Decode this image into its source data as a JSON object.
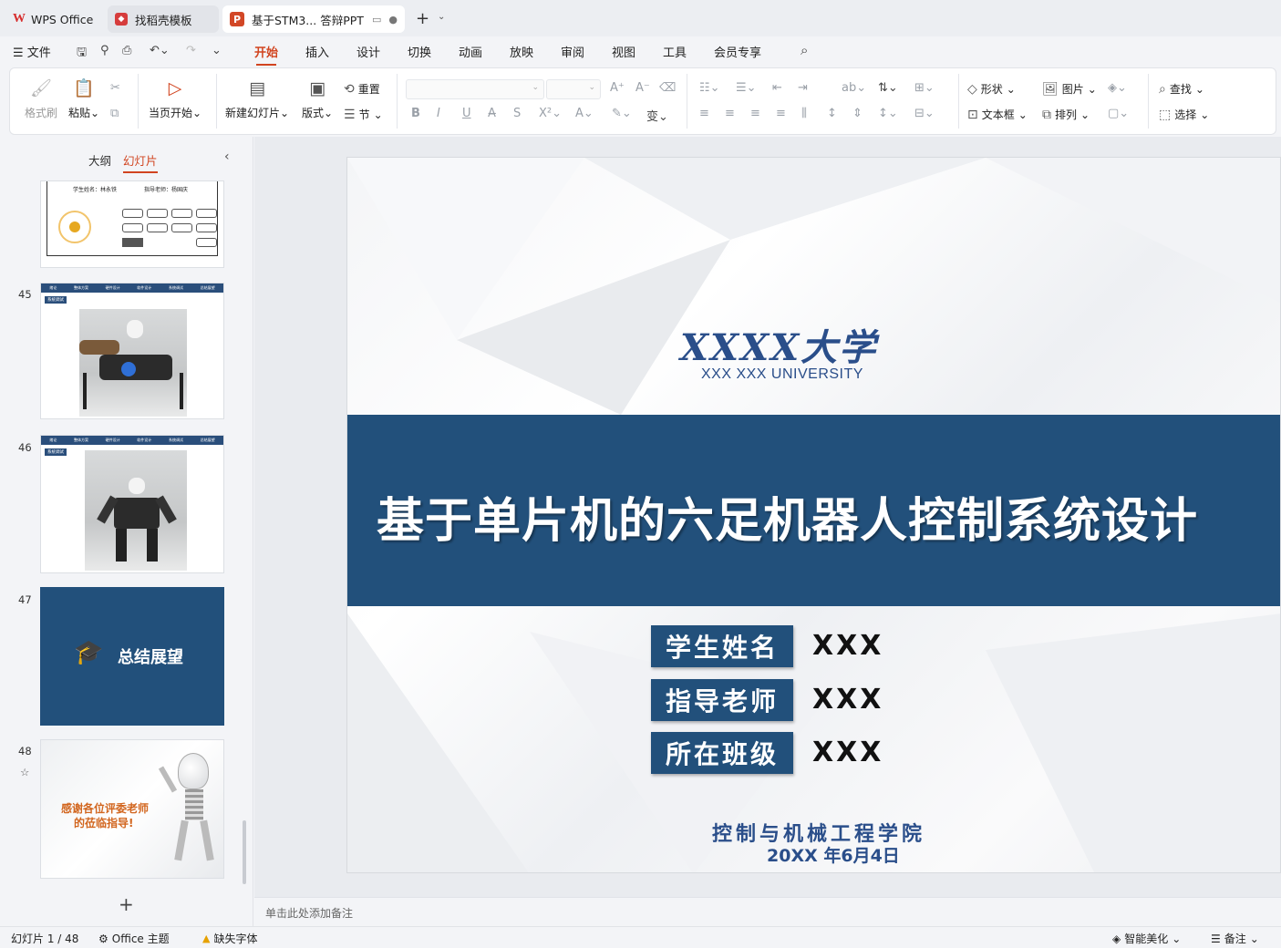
{
  "titlebar": {
    "tabs": [
      {
        "label": "WPS Office"
      },
      {
        "label": "找稻壳模板"
      },
      {
        "label": "基于STM3... 答辩PPT"
      }
    ],
    "new_tab": "+"
  },
  "menu": {
    "file": "文件",
    "items": [
      "开始",
      "插入",
      "设计",
      "切换",
      "动画",
      "放映",
      "审阅",
      "视图",
      "工具",
      "会员专享"
    ],
    "active": "开始"
  },
  "ribbon": {
    "format_painter": "格式刷",
    "paste": "粘贴",
    "from_current": "当页开始",
    "new_slide": "新建幻灯片",
    "layout": "版式",
    "reset": "重置",
    "section": "节",
    "shape": "形状",
    "picture": "图片",
    "textbox": "文本框",
    "arrange": "排列",
    "find": "查找",
    "select": "选择"
  },
  "panel": {
    "tab_outline": "大纲",
    "tab_slides": "幻灯片",
    "slide_numbers": [
      "45",
      "46",
      "47",
      "48"
    ],
    "thumb44": {
      "student": "学生姓名：林永铁",
      "teacher": "指导老师：杨国庆"
    },
    "nav_items": [
      "绪论",
      "整体方案",
      "硬件设计",
      "软件设计",
      "系统调试",
      "总结展望"
    ],
    "section_tag": "系统调试",
    "thumb47_title": "总结展望",
    "thumb48_text_line1": "感谢各位评委老师",
    "thumb48_text_line2": "的莅临指导!"
  },
  "slide": {
    "university_cn": "XXXX大学",
    "university_en": "XXX  XXX  UNIVERSITY",
    "title": "基于单片机的六足机器人控制系统设计",
    "fields": [
      {
        "label": "学生姓名",
        "value": "XXX"
      },
      {
        "label": "指导老师",
        "value": "XXX"
      },
      {
        "label": "所在班级",
        "value": "XXX"
      }
    ],
    "college": "控制与机械工程学院",
    "date": "20XX  年6月4日"
  },
  "notes": {
    "placeholder": "单击此处添加备注"
  },
  "status": {
    "slide_counter": "幻灯片 1 / 48",
    "theme": "Office 主题",
    "missing_font": "缺失字体",
    "smart_beautify": "智能美化",
    "notes": "备注"
  },
  "colors": {
    "accent": "#d1441f",
    "slide_blue": "#22507b"
  }
}
